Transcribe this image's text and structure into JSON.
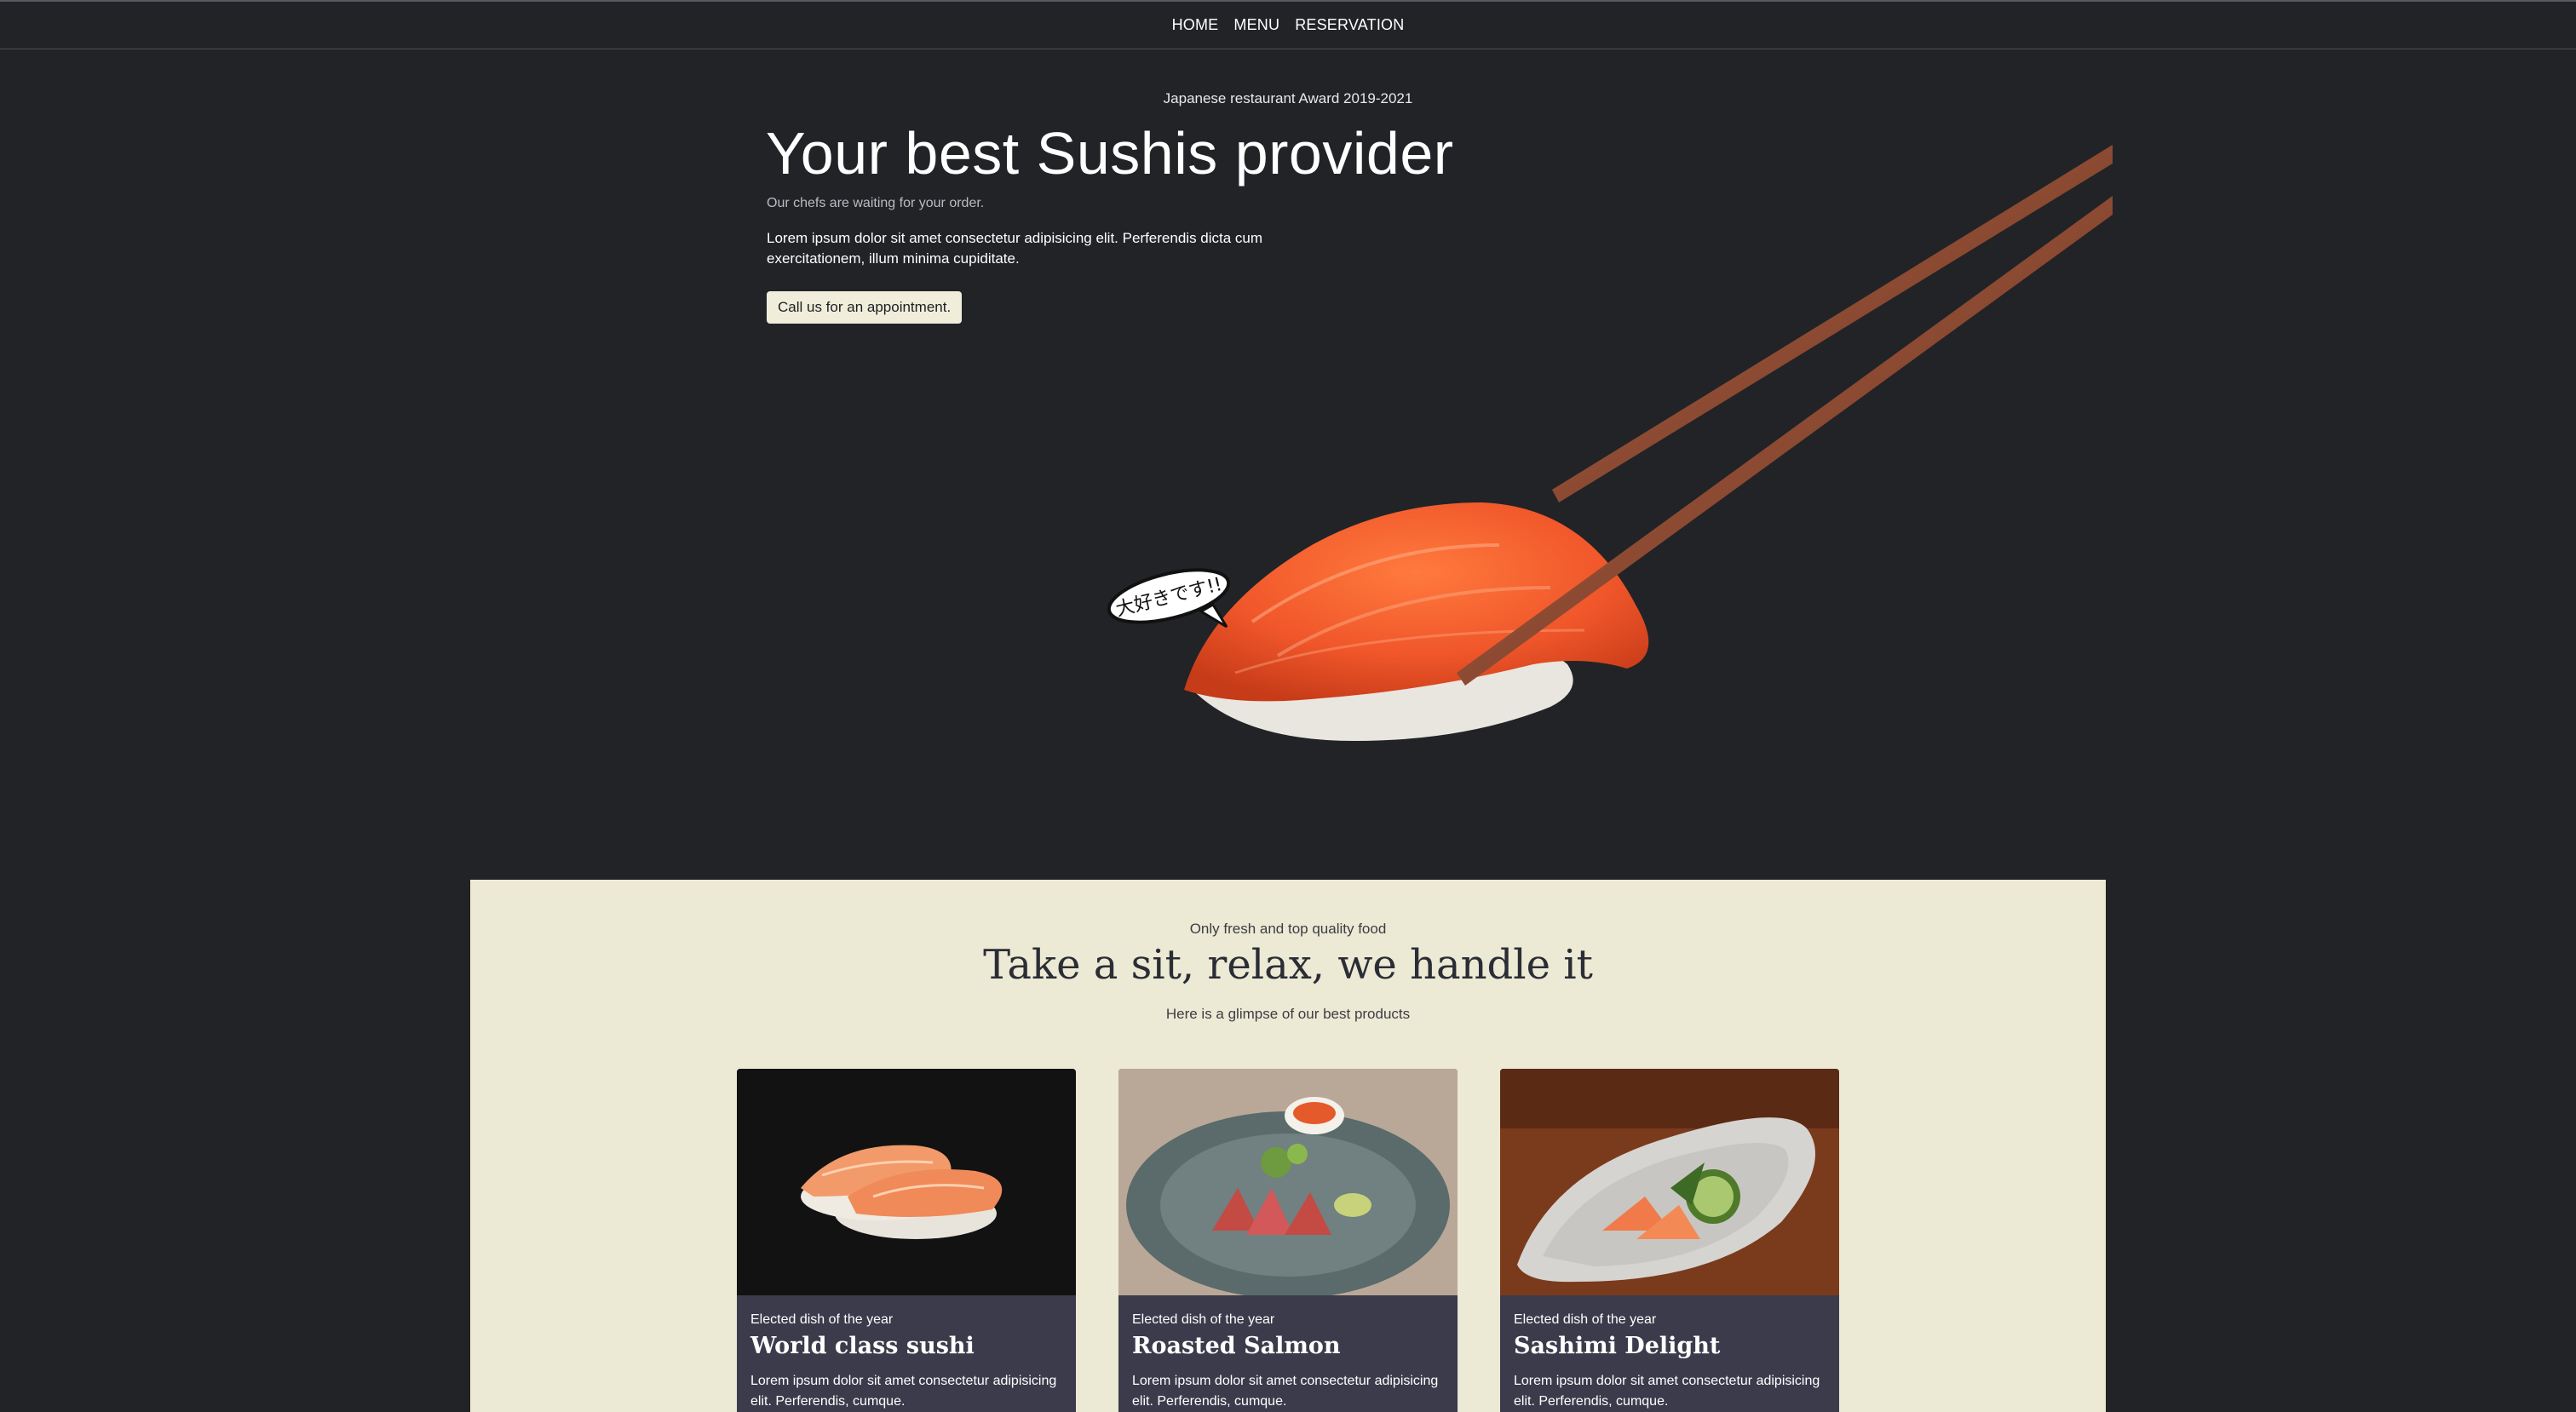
{
  "nav": {
    "items": [
      "HOME",
      "MENU",
      "RESERVATION"
    ]
  },
  "hero": {
    "award": "Japanese restaurant Award 2019-2021",
    "title": "Your best Sushis provider",
    "subtitle": "Our chefs are waiting for your order.",
    "description": "Lorem ipsum dolor sit amet consectetur adipisicing elit. Perferendis dicta cum exercitationem, illum minima cupiditate.",
    "cta_label": "Call us for an appointment.",
    "speech_bubble": "大好きです!!"
  },
  "section": {
    "kicker": "Only fresh and top quality food",
    "title": "Take a sit, relax, we handle it",
    "subtitle": "Here is a glimpse of our best products"
  },
  "cards": [
    {
      "tag": "Elected dish of the year",
      "title": "World class sushi",
      "description": "Lorem ipsum dolor sit amet consectetur adipisicing elit. Perferendis, cumque."
    },
    {
      "tag": "Elected dish of the year",
      "title": "Roasted Salmon",
      "description": "Lorem ipsum dolor sit amet consectetur adipisicing elit. Perferendis, cumque."
    },
    {
      "tag": "Elected dish of the year",
      "title": "Sashimi Delight",
      "description": "Lorem ipsum dolor sit amet consectetur adipisicing elit. Perferendis, cumque."
    }
  ],
  "colors": {
    "background": "#212327",
    "panel": "#ece9d4",
    "card": "#3c3b4c",
    "button": "#f0eddb",
    "salmon": "#f0562a"
  }
}
